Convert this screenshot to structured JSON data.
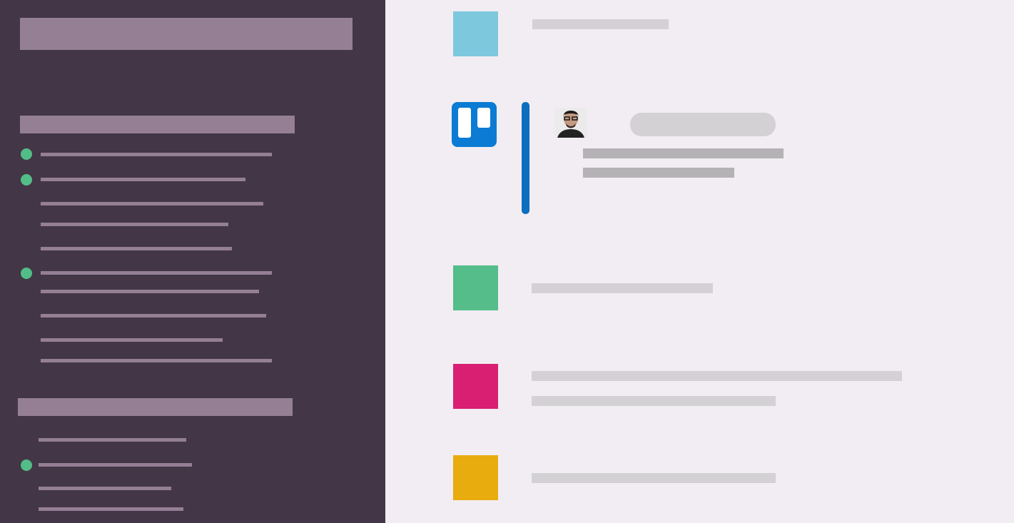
{
  "sidebar": {
    "header": "",
    "sections": [
      {
        "heading": "",
        "items": [
          {
            "label": "",
            "online": true
          },
          {
            "label": "",
            "online": true
          },
          {
            "label": "",
            "online": false
          },
          {
            "label": "",
            "online": false
          },
          {
            "label": "",
            "online": false
          },
          {
            "label": "",
            "online": true
          },
          {
            "label": "",
            "online": false
          },
          {
            "label": "",
            "online": false
          },
          {
            "label": "",
            "online": false
          },
          {
            "label": "",
            "online": false
          }
        ]
      },
      {
        "heading": "",
        "items": [
          {
            "label": "",
            "online": false
          },
          {
            "label": "",
            "online": true
          },
          {
            "label": "",
            "online": false
          },
          {
            "label": "",
            "online": false
          }
        ]
      }
    ]
  },
  "feed": {
    "messages": [
      {
        "icon": "blue-square-icon",
        "color": "#7ec8de",
        "text": ""
      },
      {
        "icon": "trello-icon",
        "color": "#0b7bd3",
        "author": "",
        "lines": [
          "",
          ""
        ]
      },
      {
        "icon": "green-square-icon",
        "color": "#55bd89",
        "text": ""
      },
      {
        "icon": "pink-square-icon",
        "color": "#d81f72",
        "lines": [
          "",
          ""
        ]
      },
      {
        "icon": "yellow-square-icon",
        "color": "#e8ac0f",
        "text": ""
      }
    ]
  },
  "colors": {
    "sidebar_bg": "#433646",
    "sidebar_text_placeholder": "#947f95",
    "online_dot": "#53bd88",
    "main_bg": "#f1edf2",
    "thread_bar": "#0b6ebf"
  }
}
